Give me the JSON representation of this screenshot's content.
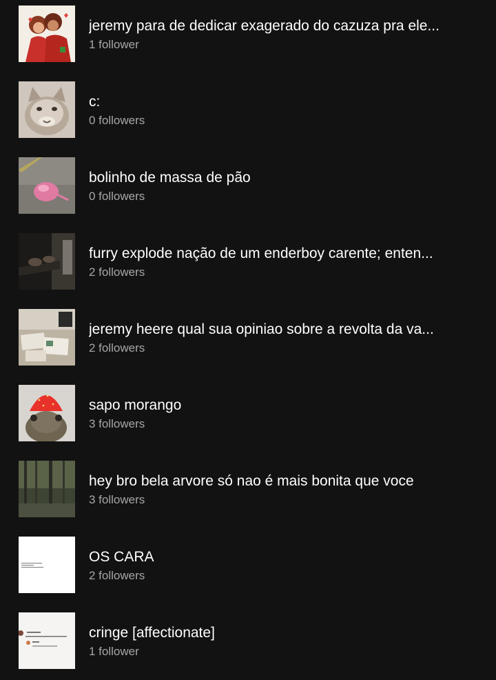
{
  "playlists": [
    {
      "title": "jeremy para de dedicar exagerado do cazuza pra ele...",
      "followers": "1 follower",
      "thumb_icon": "cartoon-couple-artwork",
      "thumb_bg": "#f3efe6"
    },
    {
      "title": "c:",
      "followers": "0 followers",
      "thumb_icon": "cat-face-photo",
      "thumb_bg": "#cfc6bd"
    },
    {
      "title": "bolinho de massa de pão",
      "followers": "0 followers",
      "thumb_icon": "pink-dough-ball-photo",
      "thumb_bg": "#8d8a84"
    },
    {
      "title": "furry explode nação de um enderboy carente; enten...",
      "followers": "2 followers",
      "thumb_icon": "piano-hands-photo",
      "thumb_bg": "#1c1a18"
    },
    {
      "title": "jeremy heere qual sua opiniao sobre a revolta da va...",
      "followers": "2 followers",
      "thumb_icon": "desk-papers-photo",
      "thumb_bg": "#bdb3a3"
    },
    {
      "title": "sapo morango",
      "followers": "3 followers",
      "thumb_icon": "frog-strawberry-hat-photo",
      "thumb_bg": "#d8d4cf"
    },
    {
      "title": "hey bro bela arvore só nao é mais bonita que voce",
      "followers": "3 followers",
      "thumb_icon": "forest-trees-photo",
      "thumb_bg": "#3e4434"
    },
    {
      "title": "OS CARA",
      "followers": "2 followers",
      "thumb_icon": "text-screenshot-image",
      "thumb_bg": "#ffffff"
    },
    {
      "title": "cringe [affectionate]",
      "followers": "1 follower",
      "thumb_icon": "chat-screenshot-image",
      "thumb_bg": "#f5f4f2"
    }
  ]
}
